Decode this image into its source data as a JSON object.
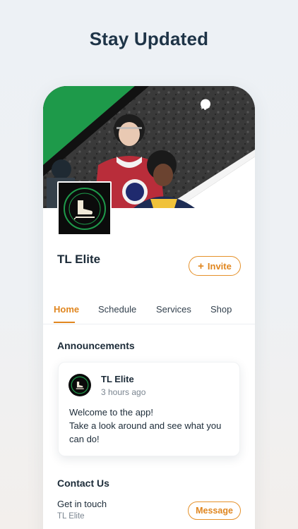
{
  "headline": "Stay Updated",
  "colors": {
    "accent": "#e0861f",
    "brand_green": "#1e9a4a",
    "text_dark": "#1c2b38"
  },
  "header_icons": [
    "chat-bubble-icon",
    "bell-icon"
  ],
  "team": {
    "name": "TL Elite",
    "logo_text": "TL ELITE · HOCKEY"
  },
  "invite": {
    "icon": "plus-icon",
    "label": "Invite"
  },
  "tabs": [
    {
      "label": "Home",
      "active": true
    },
    {
      "label": "Schedule",
      "active": false
    },
    {
      "label": "Services",
      "active": false
    },
    {
      "label": "Shop",
      "active": false
    }
  ],
  "announcements": {
    "title": "Announcements",
    "post": {
      "author": "TL Elite",
      "time": "3 hours ago",
      "lines": [
        "Welcome to the app!",
        "Take a look around and see what you",
        "can do!"
      ]
    }
  },
  "contact": {
    "title": "Contact Us",
    "label": "Get in touch",
    "sub": "TL Elite",
    "button": "Message"
  }
}
